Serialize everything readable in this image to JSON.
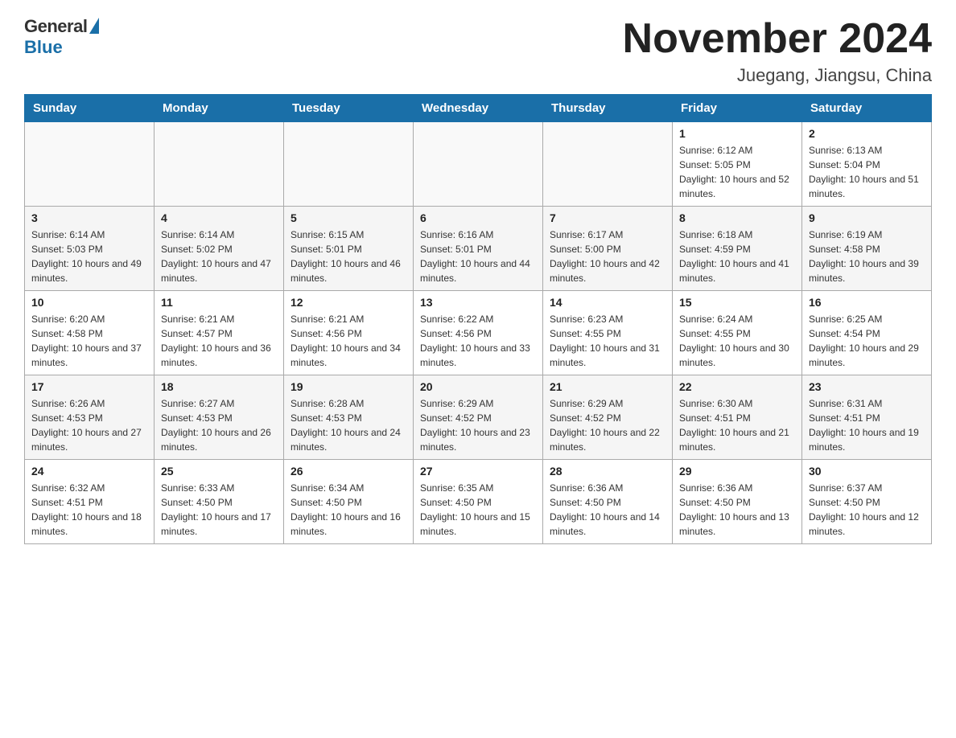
{
  "header": {
    "logo_general": "General",
    "logo_blue": "Blue",
    "month_title": "November 2024",
    "location": "Juegang, Jiangsu, China"
  },
  "weekdays": [
    "Sunday",
    "Monday",
    "Tuesday",
    "Wednesday",
    "Thursday",
    "Friday",
    "Saturday"
  ],
  "weeks": [
    [
      {
        "day": "",
        "sunrise": "",
        "sunset": "",
        "daylight": "",
        "empty": true
      },
      {
        "day": "",
        "sunrise": "",
        "sunset": "",
        "daylight": "",
        "empty": true
      },
      {
        "day": "",
        "sunrise": "",
        "sunset": "",
        "daylight": "",
        "empty": true
      },
      {
        "day": "",
        "sunrise": "",
        "sunset": "",
        "daylight": "",
        "empty": true
      },
      {
        "day": "",
        "sunrise": "",
        "sunset": "",
        "daylight": "",
        "empty": true
      },
      {
        "day": "1",
        "sunrise": "Sunrise: 6:12 AM",
        "sunset": "Sunset: 5:05 PM",
        "daylight": "Daylight: 10 hours and 52 minutes.",
        "empty": false
      },
      {
        "day": "2",
        "sunrise": "Sunrise: 6:13 AM",
        "sunset": "Sunset: 5:04 PM",
        "daylight": "Daylight: 10 hours and 51 minutes.",
        "empty": false
      }
    ],
    [
      {
        "day": "3",
        "sunrise": "Sunrise: 6:14 AM",
        "sunset": "Sunset: 5:03 PM",
        "daylight": "Daylight: 10 hours and 49 minutes.",
        "empty": false
      },
      {
        "day": "4",
        "sunrise": "Sunrise: 6:14 AM",
        "sunset": "Sunset: 5:02 PM",
        "daylight": "Daylight: 10 hours and 47 minutes.",
        "empty": false
      },
      {
        "day": "5",
        "sunrise": "Sunrise: 6:15 AM",
        "sunset": "Sunset: 5:01 PM",
        "daylight": "Daylight: 10 hours and 46 minutes.",
        "empty": false
      },
      {
        "day": "6",
        "sunrise": "Sunrise: 6:16 AM",
        "sunset": "Sunset: 5:01 PM",
        "daylight": "Daylight: 10 hours and 44 minutes.",
        "empty": false
      },
      {
        "day": "7",
        "sunrise": "Sunrise: 6:17 AM",
        "sunset": "Sunset: 5:00 PM",
        "daylight": "Daylight: 10 hours and 42 minutes.",
        "empty": false
      },
      {
        "day": "8",
        "sunrise": "Sunrise: 6:18 AM",
        "sunset": "Sunset: 4:59 PM",
        "daylight": "Daylight: 10 hours and 41 minutes.",
        "empty": false
      },
      {
        "day": "9",
        "sunrise": "Sunrise: 6:19 AM",
        "sunset": "Sunset: 4:58 PM",
        "daylight": "Daylight: 10 hours and 39 minutes.",
        "empty": false
      }
    ],
    [
      {
        "day": "10",
        "sunrise": "Sunrise: 6:20 AM",
        "sunset": "Sunset: 4:58 PM",
        "daylight": "Daylight: 10 hours and 37 minutes.",
        "empty": false
      },
      {
        "day": "11",
        "sunrise": "Sunrise: 6:21 AM",
        "sunset": "Sunset: 4:57 PM",
        "daylight": "Daylight: 10 hours and 36 minutes.",
        "empty": false
      },
      {
        "day": "12",
        "sunrise": "Sunrise: 6:21 AM",
        "sunset": "Sunset: 4:56 PM",
        "daylight": "Daylight: 10 hours and 34 minutes.",
        "empty": false
      },
      {
        "day": "13",
        "sunrise": "Sunrise: 6:22 AM",
        "sunset": "Sunset: 4:56 PM",
        "daylight": "Daylight: 10 hours and 33 minutes.",
        "empty": false
      },
      {
        "day": "14",
        "sunrise": "Sunrise: 6:23 AM",
        "sunset": "Sunset: 4:55 PM",
        "daylight": "Daylight: 10 hours and 31 minutes.",
        "empty": false
      },
      {
        "day": "15",
        "sunrise": "Sunrise: 6:24 AM",
        "sunset": "Sunset: 4:55 PM",
        "daylight": "Daylight: 10 hours and 30 minutes.",
        "empty": false
      },
      {
        "day": "16",
        "sunrise": "Sunrise: 6:25 AM",
        "sunset": "Sunset: 4:54 PM",
        "daylight": "Daylight: 10 hours and 29 minutes.",
        "empty": false
      }
    ],
    [
      {
        "day": "17",
        "sunrise": "Sunrise: 6:26 AM",
        "sunset": "Sunset: 4:53 PM",
        "daylight": "Daylight: 10 hours and 27 minutes.",
        "empty": false
      },
      {
        "day": "18",
        "sunrise": "Sunrise: 6:27 AM",
        "sunset": "Sunset: 4:53 PM",
        "daylight": "Daylight: 10 hours and 26 minutes.",
        "empty": false
      },
      {
        "day": "19",
        "sunrise": "Sunrise: 6:28 AM",
        "sunset": "Sunset: 4:53 PM",
        "daylight": "Daylight: 10 hours and 24 minutes.",
        "empty": false
      },
      {
        "day": "20",
        "sunrise": "Sunrise: 6:29 AM",
        "sunset": "Sunset: 4:52 PM",
        "daylight": "Daylight: 10 hours and 23 minutes.",
        "empty": false
      },
      {
        "day": "21",
        "sunrise": "Sunrise: 6:29 AM",
        "sunset": "Sunset: 4:52 PM",
        "daylight": "Daylight: 10 hours and 22 minutes.",
        "empty": false
      },
      {
        "day": "22",
        "sunrise": "Sunrise: 6:30 AM",
        "sunset": "Sunset: 4:51 PM",
        "daylight": "Daylight: 10 hours and 21 minutes.",
        "empty": false
      },
      {
        "day": "23",
        "sunrise": "Sunrise: 6:31 AM",
        "sunset": "Sunset: 4:51 PM",
        "daylight": "Daylight: 10 hours and 19 minutes.",
        "empty": false
      }
    ],
    [
      {
        "day": "24",
        "sunrise": "Sunrise: 6:32 AM",
        "sunset": "Sunset: 4:51 PM",
        "daylight": "Daylight: 10 hours and 18 minutes.",
        "empty": false
      },
      {
        "day": "25",
        "sunrise": "Sunrise: 6:33 AM",
        "sunset": "Sunset: 4:50 PM",
        "daylight": "Daylight: 10 hours and 17 minutes.",
        "empty": false
      },
      {
        "day": "26",
        "sunrise": "Sunrise: 6:34 AM",
        "sunset": "Sunset: 4:50 PM",
        "daylight": "Daylight: 10 hours and 16 minutes.",
        "empty": false
      },
      {
        "day": "27",
        "sunrise": "Sunrise: 6:35 AM",
        "sunset": "Sunset: 4:50 PM",
        "daylight": "Daylight: 10 hours and 15 minutes.",
        "empty": false
      },
      {
        "day": "28",
        "sunrise": "Sunrise: 6:36 AM",
        "sunset": "Sunset: 4:50 PM",
        "daylight": "Daylight: 10 hours and 14 minutes.",
        "empty": false
      },
      {
        "day": "29",
        "sunrise": "Sunrise: 6:36 AM",
        "sunset": "Sunset: 4:50 PM",
        "daylight": "Daylight: 10 hours and 13 minutes.",
        "empty": false
      },
      {
        "day": "30",
        "sunrise": "Sunrise: 6:37 AM",
        "sunset": "Sunset: 4:50 PM",
        "daylight": "Daylight: 10 hours and 12 minutes.",
        "empty": false
      }
    ]
  ]
}
